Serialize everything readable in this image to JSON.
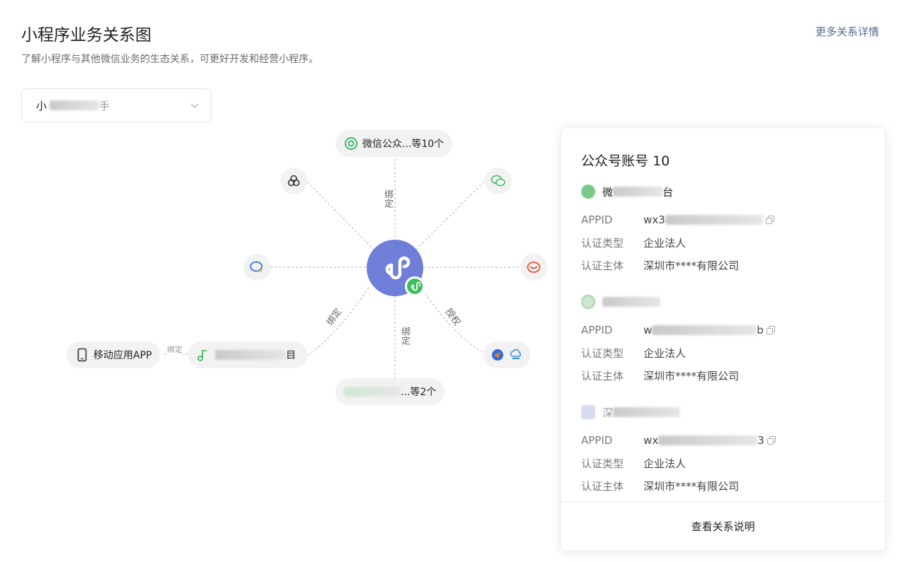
{
  "header": {
    "title": "小程序业务关系图",
    "subtitle": "了解小程序与其他微信业务的生态关系，可更好开发和经营小程序。",
    "more_link": "更多关系详情"
  },
  "selector": {
    "value_prefix": "小",
    "value_suffix": "手",
    "icon": "chevron-down-icon"
  },
  "graph": {
    "top_node": "微信公众...等10个",
    "bottom_node_suffix": "...等2个",
    "left_bottom_node_suffix": "目",
    "app_node": "移动应用APP",
    "edge_labels": {
      "top": "绑定",
      "bottom_left": "绑定",
      "bottom": "绑定",
      "bottom_right": "授权",
      "app": "绑定"
    },
    "icons": [
      "clover-icon",
      "wechat-icon",
      "chat-bubble-icon",
      "shop-icon",
      "service-icon",
      "cloud-icon",
      "miniprogram-icon",
      "phone-icon"
    ]
  },
  "panel": {
    "title": "公众号账号 10",
    "accounts": [
      {
        "name_prefix": "微",
        "name_suffix": "台",
        "appid_prefix": "wx3",
        "appid_suffix": "",
        "cert_type_label": "认证类型",
        "cert_type": "企业法人",
        "cert_subject_label": "认证主体",
        "cert_subject": "深圳市****有限公司",
        "avatar_color": "#7ac98a"
      },
      {
        "name_prefix": "",
        "name_suffix": "",
        "appid_prefix": "w",
        "appid_suffix": "b",
        "cert_type_label": "认证类型",
        "cert_type": "企业法人",
        "cert_subject_label": "认证主体",
        "cert_subject": "深圳市****有限公司",
        "avatar_color": "#cfe6cf"
      },
      {
        "name_prefix": "深",
        "name_suffix": "",
        "appid_prefix": "wx",
        "appid_suffix": "3",
        "cert_type_label": "认证类型",
        "cert_type": "企业法人",
        "cert_subject_label": "认证主体",
        "cert_subject": "深圳市****有限公司",
        "avatar_color": "#d7dcf2"
      }
    ],
    "appid_label": "APPID",
    "footer_link": "查看关系说明"
  },
  "colors": {
    "accent_link": "#576b95",
    "center_node": "#6f7fd8",
    "badge_green": "#3fbe5f"
  }
}
